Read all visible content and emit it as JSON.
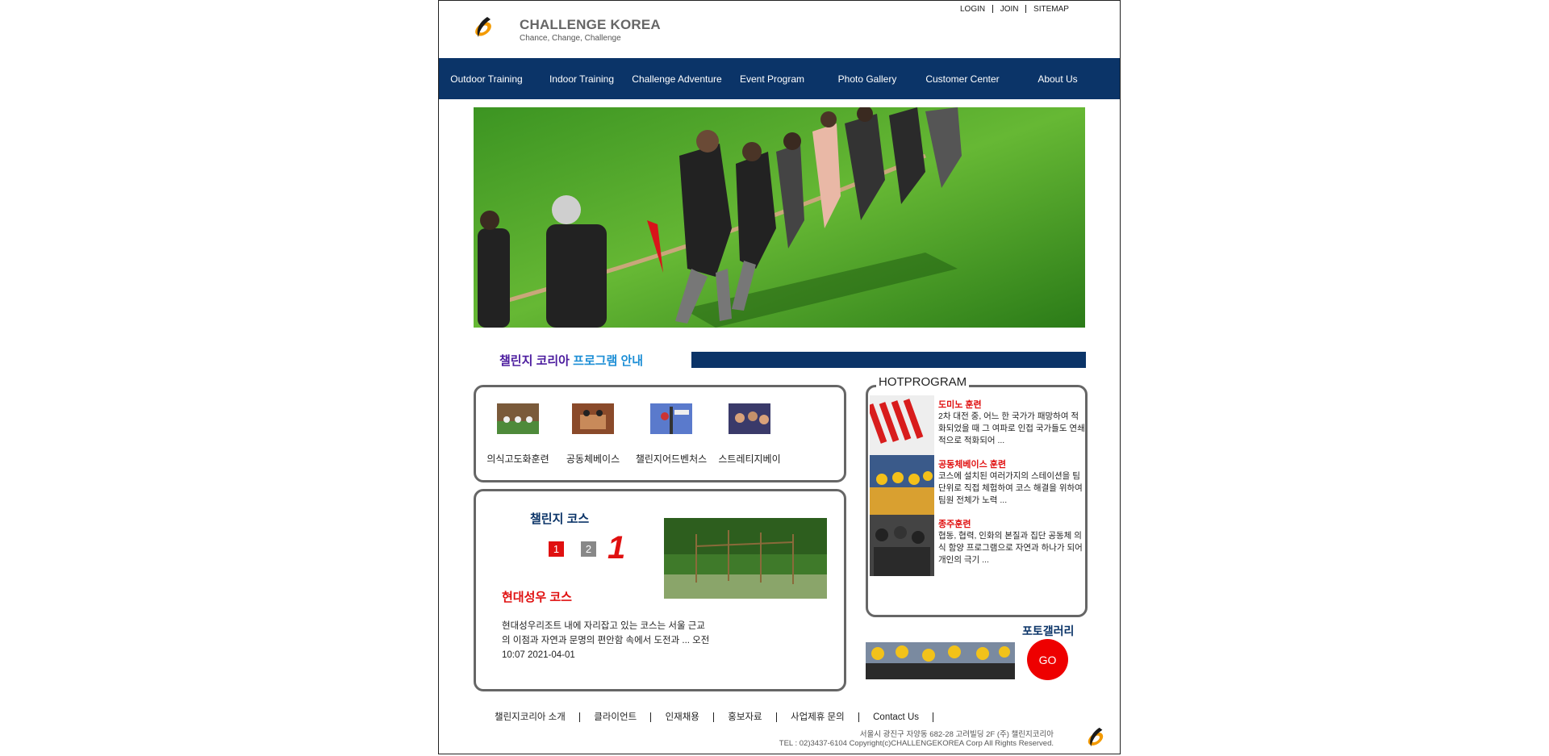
{
  "header": {
    "util_links": [
      "LOGIN",
      "JOIN",
      "SITEMAP"
    ],
    "brand_title": "CHALLENGE KOREA",
    "brand_tagline": "Chance, Change, Challenge"
  },
  "nav": {
    "items": [
      "Outdoor Training",
      "Indoor Training",
      "Challenge Adventure",
      "Event Program",
      "Photo Gallery",
      "Customer Center",
      "About Us"
    ]
  },
  "section": {
    "heading_part1": "챌린지 코리아",
    "heading_part2": "프로그램 안내"
  },
  "programs": [
    {
      "label": "의식고도화훈련"
    },
    {
      "label": "공동체베이스"
    },
    {
      "label": "챌린지어드벤처스"
    },
    {
      "label": "스트레티지베이"
    }
  ],
  "course": {
    "title": "챌린지 코스",
    "pages": [
      "1",
      "2"
    ],
    "current_indicator": "1",
    "name": "현대성우 코스",
    "description": "현대성우리조트 내에 자리잡고 있는 코스는 서울 근교의 이점과 자연과 문명의 편안함 속에서 도전과 ... 오전 10:07 2021-04-01"
  },
  "hot": {
    "legend": "HOTPROGRAM",
    "items": [
      {
        "title": "도미노 훈련",
        "desc": "2차 대전 중, 어느 한 국가가 패망하여 적화되었을 때 그 여파로 인접 국가들도 연쇄적으로 적화되어 ..."
      },
      {
        "title": "공동체베이스 훈련",
        "desc": "코스에 설치된 여러가지의 스테이션을 팀 단위로 직접 체험하여 코스 해결을 위하여 팀원 전체가 노력 ..."
      },
      {
        "title": "종주훈련",
        "desc": "협동, 협력, 인화의 본질과 집단 공동체 의식 함양 프로그램으로 자연과 하나가 되어 개인의 극기 ..."
      }
    ]
  },
  "gallery": {
    "title": "포토갤러리",
    "go_label": "GO"
  },
  "footer": {
    "links": [
      "챌린지코리아 소개",
      "클라이언트",
      "인재채용",
      "홍보자료",
      "사업제휴 문의",
      "Contact Us"
    ],
    "address": "서울시 광진구 자양동 682-28 고려빌딩 2F (주) 챌린지코리아",
    "copyright": "TEL : 02)3437-6104 Copyright(c)CHALLENGEKOREA Corp All Rights Reserved."
  },
  "colors": {
    "nav_bg": "#0b3468",
    "accent_red": "#e01010",
    "heading_purple": "#4b1b9e",
    "heading_blue": "#1e8fd6"
  }
}
